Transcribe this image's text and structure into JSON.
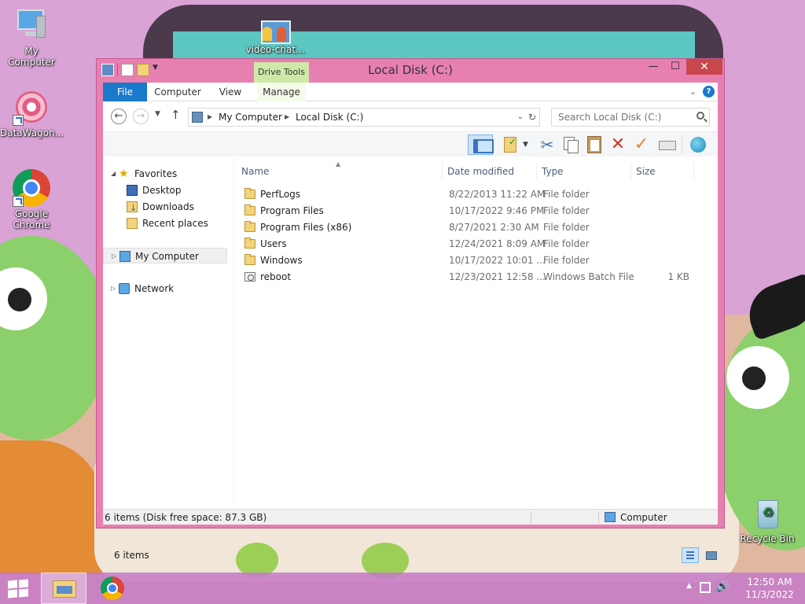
{
  "desktop": {
    "icons": [
      {
        "label": "My Computer"
      },
      {
        "label": "DataWagon..."
      },
      {
        "label": "Google Chrome"
      },
      {
        "label": "video-chat..."
      },
      {
        "label": "Recycle Bin"
      }
    ]
  },
  "window": {
    "title": "Local Disk (C:)",
    "context_tab": "Drive Tools",
    "ribbon_tabs": [
      "File",
      "Computer",
      "View",
      "Manage"
    ],
    "help_label": "?"
  },
  "address": {
    "crumbs": [
      "My Computer",
      "Local Disk (C:)"
    ]
  },
  "search": {
    "placeholder": "Search Local Disk (C:)"
  },
  "nav_pane": {
    "favorites": "Favorites",
    "favorites_items": [
      "Desktop",
      "Downloads",
      "Recent places"
    ],
    "my_computer": "My Computer",
    "network": "Network"
  },
  "columns": [
    "Name",
    "Date modified",
    "Type",
    "Size"
  ],
  "files": [
    {
      "name": "PerfLogs",
      "date": "8/22/2013 11:22 AM",
      "type": "File folder",
      "size": "",
      "icon": "folder-icon"
    },
    {
      "name": "Program Files",
      "date": "10/17/2022 9:46 PM",
      "type": "File folder",
      "size": "",
      "icon": "folder-icon"
    },
    {
      "name": "Program Files (x86)",
      "date": "8/27/2021 2:30 AM",
      "type": "File folder",
      "size": "",
      "icon": "folder-icon"
    },
    {
      "name": "Users",
      "date": "12/24/2021 8:09 AM",
      "type": "File folder",
      "size": "",
      "icon": "folder-icon"
    },
    {
      "name": "Windows",
      "date": "10/17/2022 10:01 ...",
      "type": "File folder",
      "size": "",
      "icon": "folder-icon"
    },
    {
      "name": "reboot",
      "date": "12/23/2021 12:58 ...",
      "type": "Windows Batch File",
      "size": "1 KB",
      "icon": "batch-file-icon"
    }
  ],
  "item_count": "6 items",
  "status": {
    "left": "6 items (Disk free space: 87.3 GB)",
    "right": "Computer"
  },
  "taskbar": {
    "time": "12:50 AM",
    "date": "11/3/2022"
  },
  "colors": {
    "window_frame": "#e87fb1",
    "file_tab": "#1979ca",
    "context_tab": "#cfe8a8",
    "close_button": "#c7474c"
  }
}
